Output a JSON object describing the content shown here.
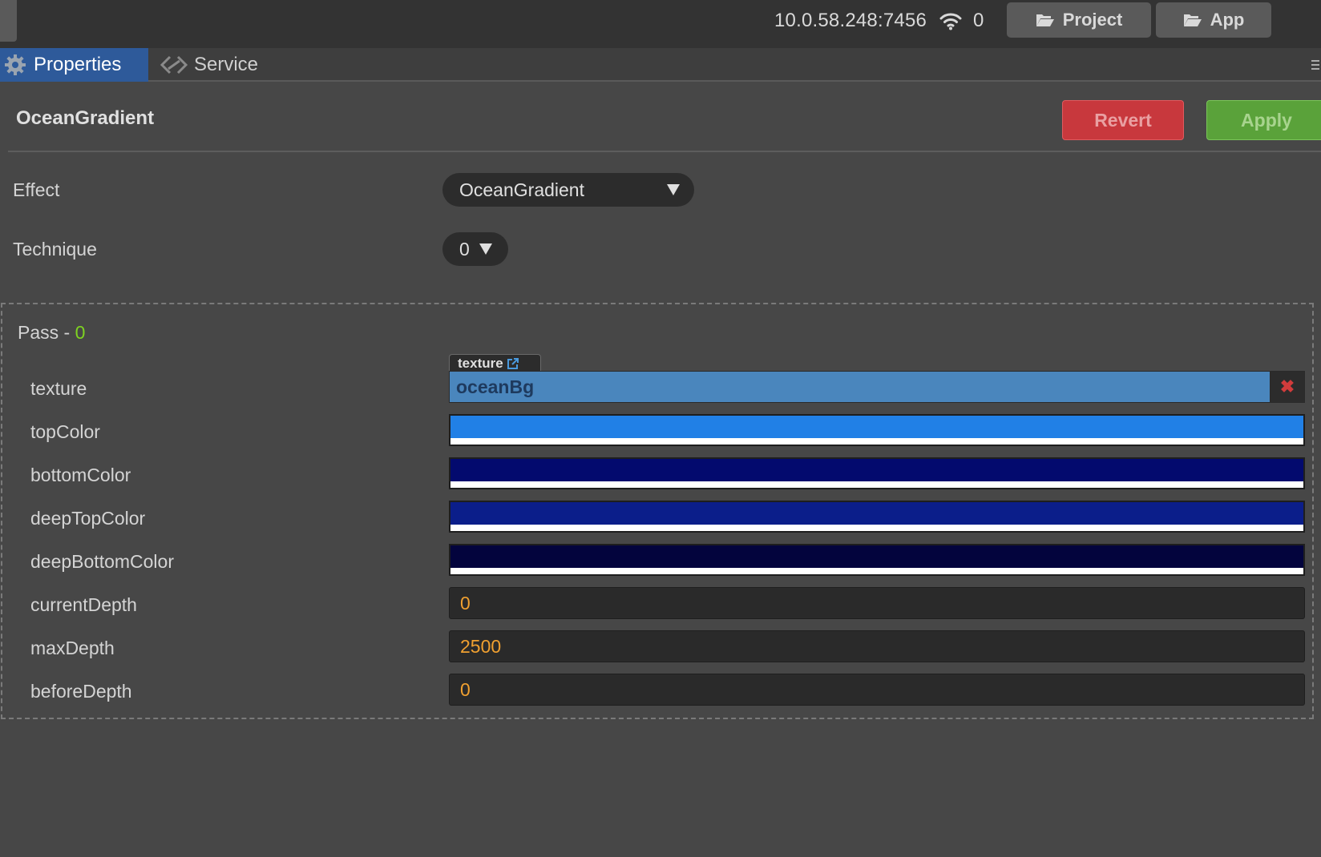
{
  "topbar": {
    "ip": "10.0.58.248:7456",
    "connections": "0",
    "project_label": "Project",
    "app_label": "App"
  },
  "tabs": [
    {
      "label": "Properties",
      "icon": "gear-icon",
      "active": true
    },
    {
      "label": "Service",
      "icon": "service-icon",
      "active": false
    }
  ],
  "header": {
    "title": "OceanGradient",
    "revert_label": "Revert",
    "apply_label": "Apply"
  },
  "effect": {
    "label": "Effect",
    "value": "OceanGradient"
  },
  "technique": {
    "label": "Technique",
    "value": "0"
  },
  "pass": {
    "label": "Pass - ",
    "index": "0",
    "texture": {
      "label": "texture",
      "tag": "texture",
      "value": "oceanBg"
    },
    "colors": [
      {
        "label": "topColor",
        "color": "#2180e6"
      },
      {
        "label": "bottomColor",
        "color": "#030a6e"
      },
      {
        "label": "deepTopColor",
        "color": "#0b1e8a"
      },
      {
        "label": "deepBottomColor",
        "color": "#03043d"
      }
    ],
    "numbers": [
      {
        "label": "currentDepth",
        "value": "0"
      },
      {
        "label": "maxDepth",
        "value": "2500"
      },
      {
        "label": "beforeDepth",
        "value": "0"
      }
    ]
  },
  "colors": {
    "tab_active": "#2e5a9a",
    "revert": "#c8383d",
    "apply": "#5aa23a",
    "number_text": "#f0a030",
    "pass_index": "#7ed321"
  }
}
